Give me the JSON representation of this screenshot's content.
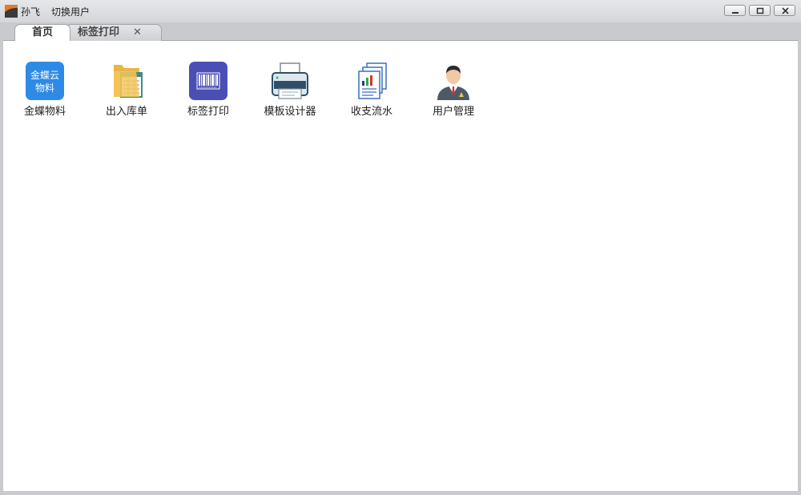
{
  "titlebar": {
    "user_name": "孙飞",
    "switch_user": "切换用户"
  },
  "tabs": [
    {
      "label": "首页",
      "active": true,
      "closable": false
    },
    {
      "label": "标签打印",
      "active": false,
      "closable": true,
      "close_glyph": "✕"
    }
  ],
  "apps": [
    {
      "label": "金蝶物料",
      "icon": "kingdee-cloud-icon",
      "icon_text": [
        "金蝶云",
        "物料"
      ]
    },
    {
      "label": "出入库单",
      "icon": "folder-list-icon"
    },
    {
      "label": "标签打印",
      "icon": "barcode-icon"
    },
    {
      "label": "模板设计器",
      "icon": "printer-icon"
    },
    {
      "label": "收支流水",
      "icon": "report-documents-icon"
    },
    {
      "label": "用户管理",
      "icon": "user-manager-icon"
    }
  ],
  "colors": {
    "kingdee_blue": "#2d8be6",
    "barcode_purple": "#4b4fb3",
    "folder_yellow": "#f6c75b"
  }
}
